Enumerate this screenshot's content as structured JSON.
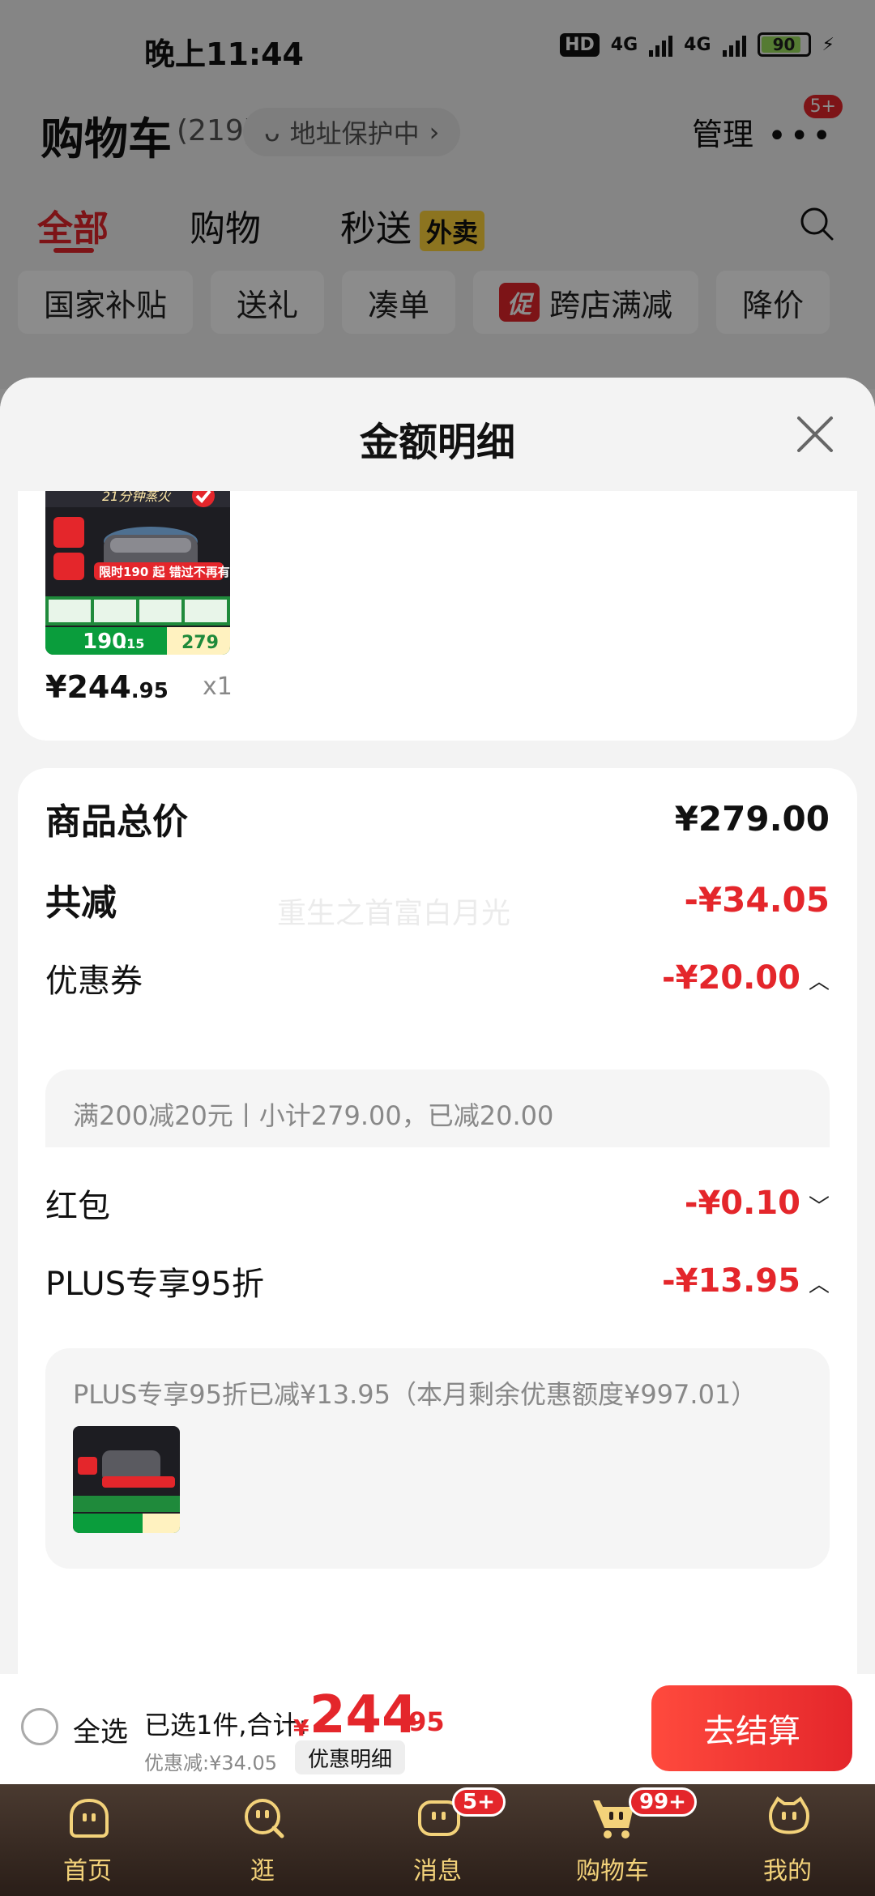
{
  "status_bar": {
    "time": "晚上11:44",
    "hd": "HD",
    "net1": "4G",
    "net2": "4G",
    "battery": "90"
  },
  "cart_header": {
    "title": "购物车",
    "count": "(219)",
    "address_protect": "地址保护中",
    "manage": "管理",
    "more_badge": "5+"
  },
  "tabs": {
    "all": "全部",
    "shopping": "购物",
    "instant": "秒送",
    "takeout_badge": "外卖"
  },
  "chips": [
    {
      "label": "国家补贴"
    },
    {
      "label": "送礼"
    },
    {
      "label": "凑单"
    },
    {
      "label": "跨店满减",
      "tag": "促"
    },
    {
      "label": "降价"
    }
  ],
  "sheet": {
    "title": "金额明细"
  },
  "product": {
    "price_int": "¥244",
    "price_dec": ".95",
    "qty": "x1",
    "thumb_price1": "190",
    "thumb_price1_dec": ".15",
    "thumb_price2": "279",
    "thumb_banner": "限时190 起 错过不再有!",
    "thumb_top": "21分钟蒸火"
  },
  "breakdown": {
    "goods_total_label": "商品总价",
    "goods_total_value": "¥279.00",
    "total_reduce_label": "共减",
    "total_reduce_value": "-¥34.05",
    "watermark": "重生之首富白月光",
    "coupon_label": "优惠券",
    "coupon_value": "-¥20.00",
    "coupon_detail": "满200减20元丨小计279.00，已减20.00",
    "redpacket_label": "红包",
    "redpacket_value": "-¥0.10",
    "plus_label": "PLUS专享95折",
    "plus_value": "-¥13.95",
    "plus_detail": "PLUS专享95折已减¥13.95（本月剩余优惠额度¥997.01）"
  },
  "checkout": {
    "select_all": "全选",
    "selected_info": "已选1件,合计:",
    "yen": "¥",
    "total_int": "244",
    "total_dec": ".95",
    "discount_info": "优惠减:¥34.05",
    "detail_button": "优惠明细",
    "checkout_button": "去结算"
  },
  "bottom_nav": [
    {
      "label": "首页",
      "icon": "home-icon"
    },
    {
      "label": "逛",
      "icon": "browse-icon"
    },
    {
      "label": "消息",
      "icon": "message-icon",
      "badge": "5+"
    },
    {
      "label": "购物车",
      "icon": "cart-icon",
      "badge": "99+"
    },
    {
      "label": "我的",
      "icon": "profile-icon"
    }
  ],
  "colors": {
    "accent": "#e4262b",
    "nav_bg": "#2a1e18",
    "nav_text": "#f3d27a"
  }
}
